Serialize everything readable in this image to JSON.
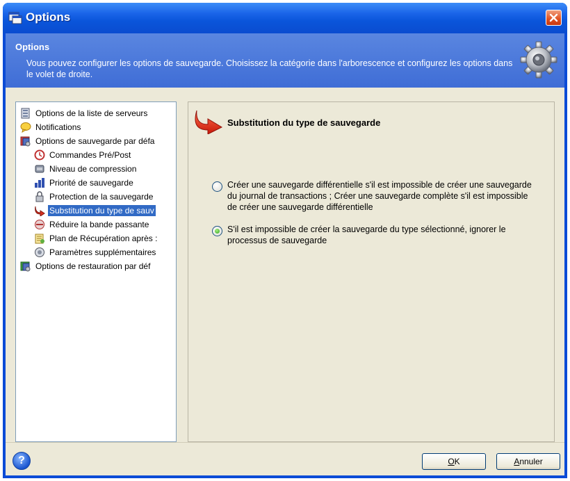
{
  "window": {
    "title": "Options",
    "accent_color": "#0b4bd6"
  },
  "header": {
    "title": "Options",
    "description": "Vous pouvez configurer les options de sauvegarde. Choisissez la catégorie dans l'arborescence et configurez les options dans le volet de droite."
  },
  "tree": {
    "items": [
      {
        "label": "Options de la liste de serveurs",
        "level": 0,
        "icon": "server-list-icon"
      },
      {
        "label": "Notifications",
        "level": 0,
        "icon": "notification-icon"
      },
      {
        "label": "Options de sauvegarde par défa",
        "level": 0,
        "icon": "backup-options-icon"
      },
      {
        "label": "Commandes Pré/Post",
        "level": 1,
        "icon": "command-icon"
      },
      {
        "label": "Niveau de compression",
        "level": 1,
        "icon": "compression-icon"
      },
      {
        "label": "Priorité de sauvegarde",
        "level": 1,
        "icon": "priority-icon"
      },
      {
        "label": "Protection de la sauvegarde",
        "level": 1,
        "icon": "protection-icon"
      },
      {
        "label": "Substitution du type de sauv",
        "level": 1,
        "icon": "substitution-icon",
        "selected": true
      },
      {
        "label": "Réduire la bande passante",
        "level": 1,
        "icon": "bandwidth-icon"
      },
      {
        "label": "Plan de Récupération après :",
        "level": 1,
        "icon": "recovery-plan-icon"
      },
      {
        "label": "Paramètres supplémentaires",
        "level": 1,
        "icon": "settings-icon"
      },
      {
        "label": "Options de restauration par déf",
        "level": 0,
        "icon": "restore-options-icon"
      }
    ]
  },
  "panel": {
    "title": "Substitution du type de sauvegarde",
    "options": [
      {
        "label": "Créer une sauvegarde différentielle s'il est impossible de créer une sauvegarde du journal de transactions ; Créer une sauvegarde complète s'il est impossible de créer une sauvegarde différentielle",
        "checked": false
      },
      {
        "label": "S'il est impossible de créer la sauvegarde du type sélectionné, ignorer le processus de sauvegarde",
        "checked": true
      }
    ]
  },
  "footer": {
    "help": "?",
    "ok_label": "OK",
    "ok_rest": "K",
    "ok_mnemonic": "O",
    "cancel_label": "Annuler",
    "cancel_mnemonic": "A",
    "cancel_rest": "nnuler"
  }
}
